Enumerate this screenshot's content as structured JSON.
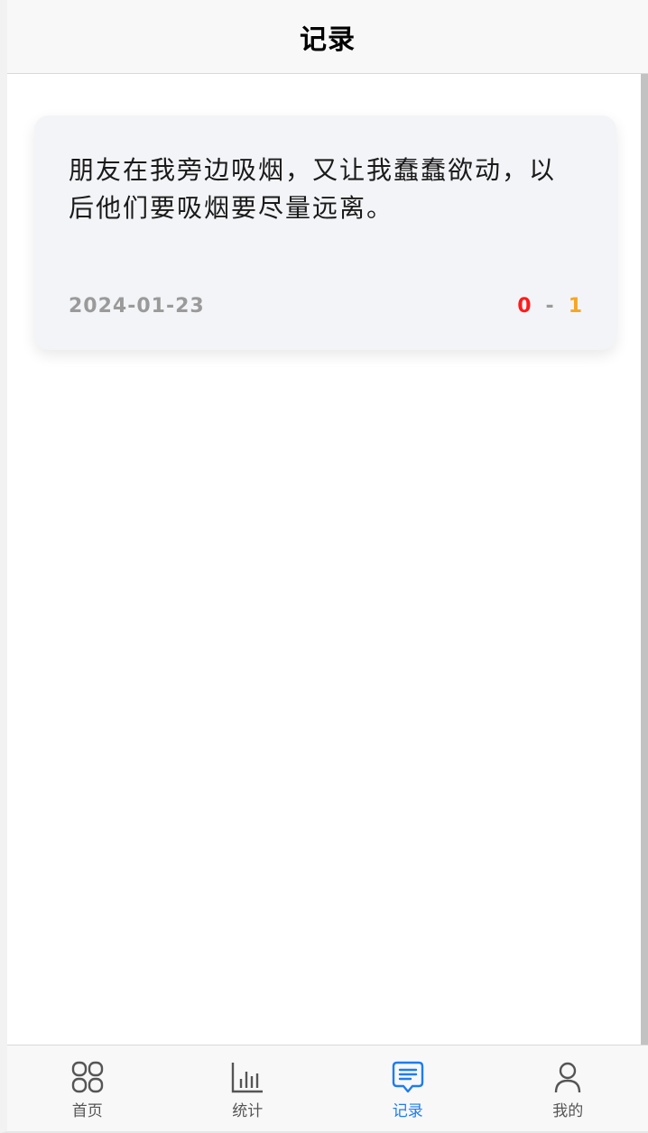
{
  "header": {
    "title": "记录"
  },
  "record": {
    "text": "朋友在我旁边吸烟，又让我蠢蠢欲动，以后他们要吸烟要尽量远离。",
    "date": "2024-01-23",
    "score_left": "0",
    "score_separator": "-",
    "score_right": "1"
  },
  "tabbar": {
    "active_color": "#1e7cf0",
    "items": [
      {
        "label": "首页",
        "icon": "grid-icon"
      },
      {
        "label": "统计",
        "icon": "bar-chart-icon"
      },
      {
        "label": "记录",
        "icon": "message-icon",
        "active": true
      },
      {
        "label": "我的",
        "icon": "user-icon"
      }
    ]
  }
}
